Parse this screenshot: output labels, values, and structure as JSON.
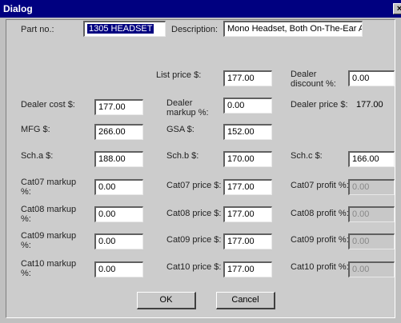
{
  "window": {
    "title": "Dialog",
    "close_glyph": "×"
  },
  "part_no": {
    "label": "Part no.:",
    "value": "1305 HEADSET"
  },
  "description": {
    "label": "Description:",
    "value": "Mono Headset, Both On-The-Ear A"
  },
  "list_price": {
    "label": "List price $:",
    "value": "177.00"
  },
  "dealer_discount": {
    "label": "Dealer discount %:",
    "value": "0.00"
  },
  "dealer_cost": {
    "label": "Dealer cost $:",
    "value": "177.00"
  },
  "dealer_markup": {
    "label": "Dealer markup %:",
    "value": "0.00"
  },
  "dealer_price": {
    "label": "Dealer price $:",
    "value": "177.00"
  },
  "mfg": {
    "label": "MFG $:",
    "value": "266.00"
  },
  "gsa": {
    "label": "GSA $:",
    "value": "152.00"
  },
  "sch_a": {
    "label": "Sch.a $:",
    "value": "188.00"
  },
  "sch_b": {
    "label": "Sch.b $:",
    "value": "170.00"
  },
  "sch_c": {
    "label": "Sch.c $:",
    "value": "166.00"
  },
  "categories": [
    {
      "markup_label": "Cat07 markup %:",
      "markup": "0.00",
      "price_label": "Cat07 price $:",
      "price": "177.00",
      "profit_label": "Cat07 profit %:",
      "profit": "0.00"
    },
    {
      "markup_label": "Cat08 markup %:",
      "markup": "0.00",
      "price_label": "Cat08 price $:",
      "price": "177.00",
      "profit_label": "Cat08 profit %:",
      "profit": "0.00"
    },
    {
      "markup_label": "Cat09 markup %:",
      "markup": "0.00",
      "price_label": "Cat09 price $:",
      "price": "177.00",
      "profit_label": "Cat09 profit %:",
      "profit": "0.00"
    },
    {
      "markup_label": "Cat10 markup %:",
      "markup": "0.00",
      "price_label": "Cat10 price $:",
      "price": "177.00",
      "profit_label": "Cat10 profit %:",
      "profit": "0.00"
    }
  ],
  "buttons": {
    "ok": "OK",
    "cancel": "Cancel"
  }
}
